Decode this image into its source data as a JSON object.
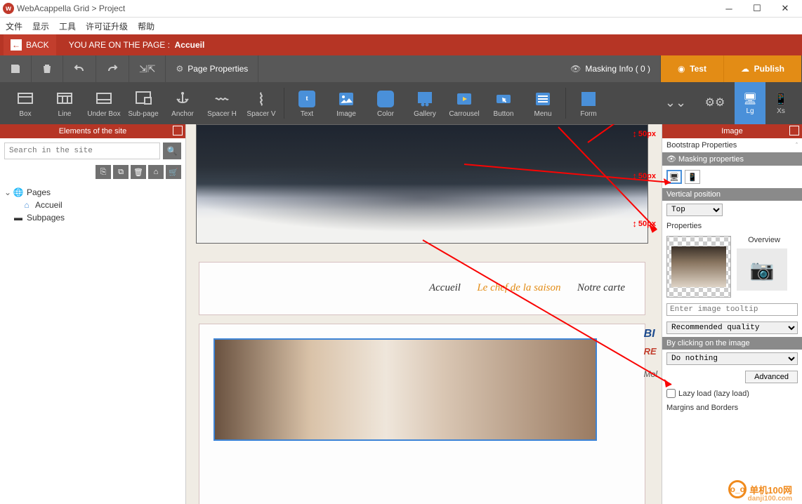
{
  "title": "WebAcappella Grid > Project",
  "menus": [
    "文件",
    "显示",
    "工具",
    "许可证升级",
    "帮助"
  ],
  "back": "BACK",
  "page_label": "YOU ARE ON THE PAGE :",
  "page_name": "Accueil",
  "toolbar": {
    "page_props": "Page Properties",
    "masking": "Masking Info ( 0 )",
    "test": "Test",
    "publish": "Publish"
  },
  "palette": {
    "box": "Box",
    "line": "Line",
    "underbox": "Under Box",
    "subpage": "Sub-page",
    "anchor": "Anchor",
    "spacerh": "Spacer H",
    "spacerv": "Spacer V",
    "text": "Text",
    "image": "Image",
    "color": "Color",
    "gallery": "Gallery",
    "carrousel": "Carrousel",
    "button": "Button",
    "menu": "Menu",
    "form": "Form",
    "lg": "Lg",
    "xs": "Xs"
  },
  "left": {
    "title": "Elements of the site",
    "search_ph": "Search in the site",
    "pages": "Pages",
    "accueil": "Accueil",
    "subpages": "Subpages"
  },
  "canvas": {
    "spacing": "50px",
    "nav": {
      "accueil": "Accueil",
      "chef": "Le chef de la saison",
      "carte": "Notre carte"
    },
    "side": {
      "t1": "BI",
      "t2": "RE",
      "t3": "Mol"
    }
  },
  "right": {
    "title": "Image",
    "bootstrap": "Bootstrap Properties",
    "masking": "Masking properties",
    "vpos_title": "Vertical position",
    "vpos_val": "Top",
    "props": "Properties",
    "overview": "Overview",
    "tooltip_ph": "Enter image tooltip",
    "quality": "Recommended quality",
    "click_title": "By clicking on the image",
    "click_val": "Do nothing",
    "advanced": "Advanced",
    "lazy": "Lazy load (lazy load)",
    "margins": "Margins and Borders"
  },
  "watermark": {
    "name": "单机100网",
    "url": "danji100.com"
  }
}
